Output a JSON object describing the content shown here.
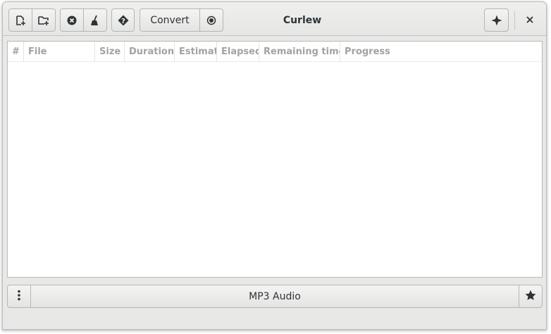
{
  "window": {
    "title": "Curlew"
  },
  "toolbar": {
    "convert_label": "Convert",
    "icons": [
      "add-file-icon",
      "add-folder-icon",
      "remove-icon",
      "clear-icon",
      "info-icon",
      "stop-icon",
      "menu-star-icon",
      "close-icon"
    ]
  },
  "list": {
    "columns": [
      "#",
      "File",
      "Size",
      "Duration",
      "Estimate",
      "Elapsed",
      "Remaining time",
      "Progress"
    ],
    "rows": []
  },
  "bottom": {
    "preset": "MP3 Audio"
  },
  "colors": {
    "window_bg": "#e8e8e7",
    "header_text": "#a0a3a4",
    "text": "#2e3436"
  }
}
